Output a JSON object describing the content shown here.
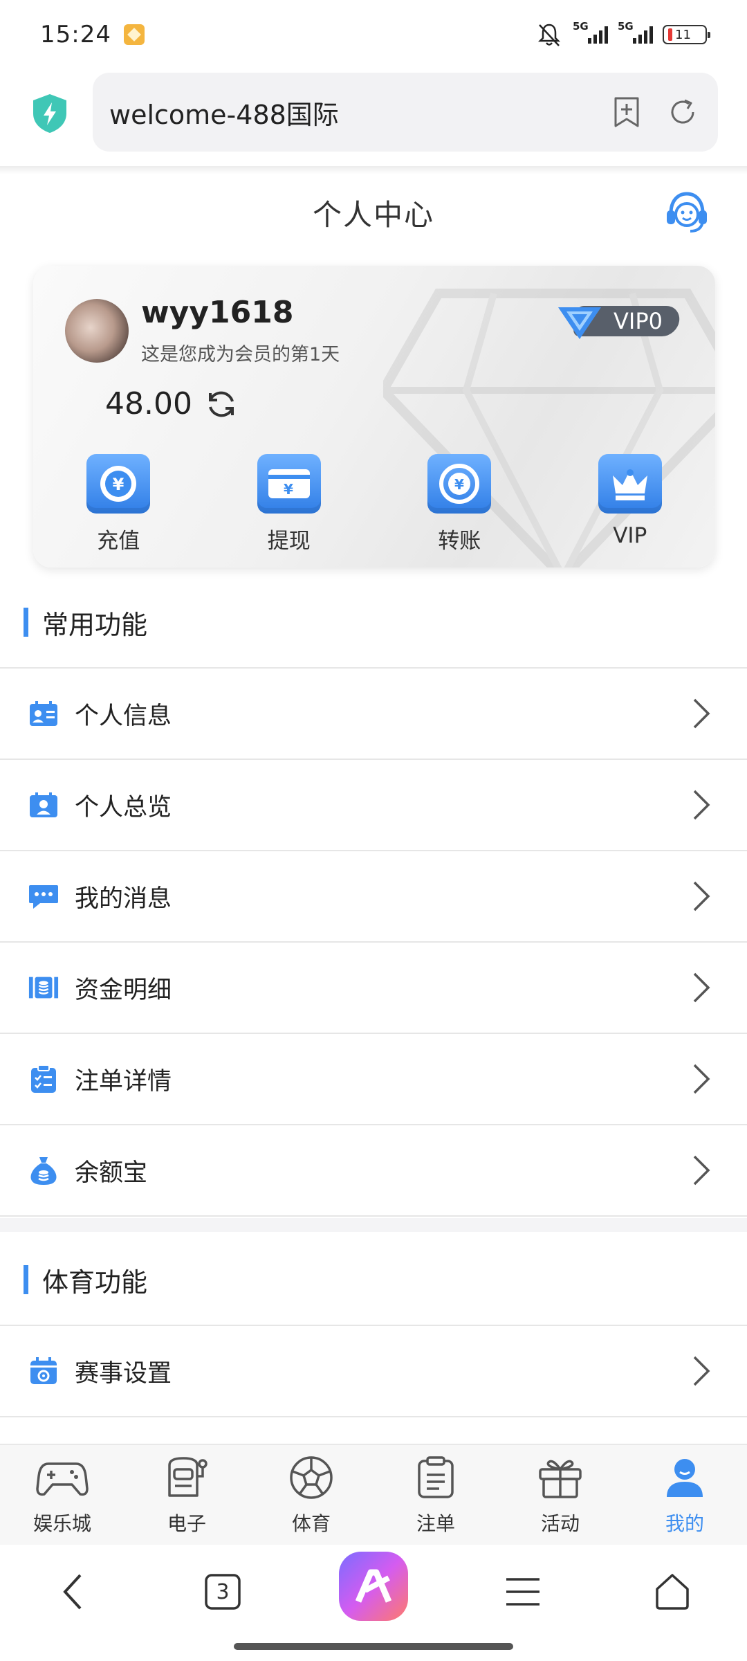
{
  "status_bar": {
    "time": "15:24",
    "signal1_label": "5G",
    "signal2_label": "5G",
    "battery_level": "11"
  },
  "browser": {
    "url_text": "welcome-488国际"
  },
  "header": {
    "title": "个人中心"
  },
  "member_card": {
    "username": "wyy1618",
    "member_days_text": "这是您成为会员的第1天",
    "vip_level": "VIP0",
    "balance": "48.00",
    "actions": [
      {
        "label": "充值",
        "icon": "recharge-icon"
      },
      {
        "label": "提现",
        "icon": "withdraw-icon"
      },
      {
        "label": "转账",
        "icon": "transfer-icon"
      },
      {
        "label": "VIP",
        "icon": "crown-icon"
      }
    ]
  },
  "common_section": {
    "title": "常用功能",
    "items": [
      {
        "label": "个人信息",
        "icon": "id-card-icon"
      },
      {
        "label": "个人总览",
        "icon": "profile-overview-icon"
      },
      {
        "label": "我的消息",
        "icon": "message-icon"
      },
      {
        "label": "资金明细",
        "icon": "funds-icon"
      },
      {
        "label": "注单详情",
        "icon": "clipboard-list-icon"
      },
      {
        "label": "余额宝",
        "icon": "money-bag-icon"
      }
    ]
  },
  "sports_section": {
    "title": "体育功能",
    "items": [
      {
        "label": "赛事设置",
        "icon": "calendar-gear-icon"
      }
    ]
  },
  "tabbar": {
    "items": [
      {
        "label": "娱乐城",
        "icon": "gamepad-icon"
      },
      {
        "label": "电子",
        "icon": "slot-machine-icon"
      },
      {
        "label": "体育",
        "icon": "soccer-ball-icon"
      },
      {
        "label": "注单",
        "icon": "clipboard-icon"
      },
      {
        "label": "活动",
        "icon": "gift-icon"
      },
      {
        "label": "我的",
        "icon": "user-icon"
      }
    ],
    "active_index": 5
  },
  "system_nav": {
    "tab_count": "3"
  },
  "colors": {
    "accent": "#3d8ef0",
    "vip_pill": "#585f6a"
  }
}
